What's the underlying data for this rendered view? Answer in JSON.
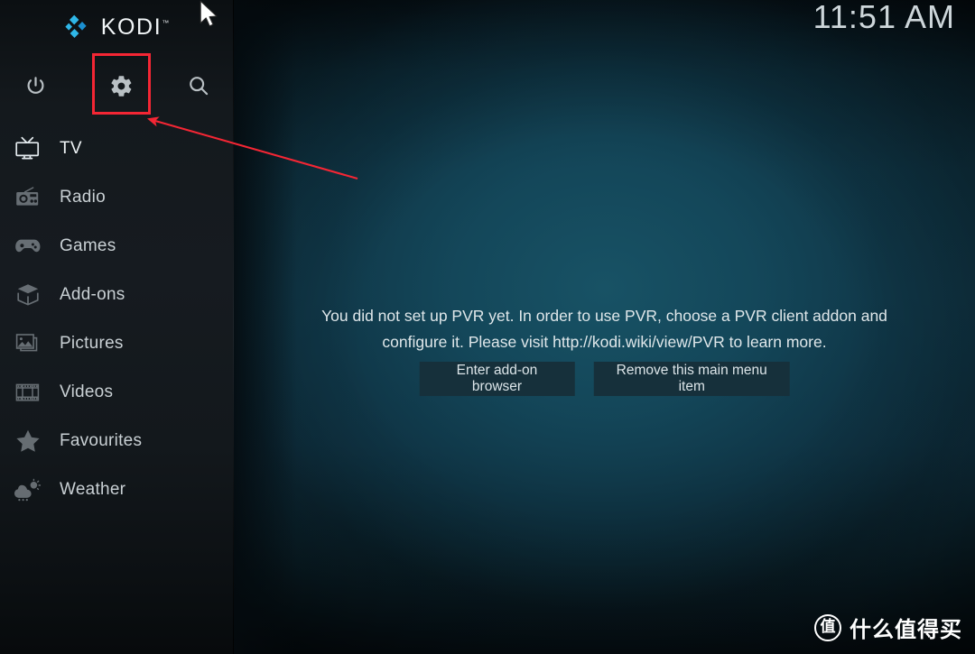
{
  "app": {
    "name": "KODI",
    "trademark": "™"
  },
  "status_bar": {
    "clock": "11:51 AM"
  },
  "sidebar": {
    "top_actions": [
      {
        "name": "power-button",
        "icon": "power-icon",
        "label": "Power"
      },
      {
        "name": "settings-button",
        "icon": "gear-icon",
        "label": "Settings"
      },
      {
        "name": "search-button",
        "icon": "search-icon",
        "label": "Search"
      }
    ],
    "items": [
      {
        "label": "TV",
        "icon": "tv-icon",
        "active": true
      },
      {
        "label": "Radio",
        "icon": "radio-icon",
        "active": false
      },
      {
        "label": "Games",
        "icon": "gamepad-icon",
        "active": false
      },
      {
        "label": "Add-ons",
        "icon": "box-icon",
        "active": false
      },
      {
        "label": "Pictures",
        "icon": "picture-icon",
        "active": false
      },
      {
        "label": "Videos",
        "icon": "filmstrip-icon",
        "active": false
      },
      {
        "label": "Favourites",
        "icon": "star-icon",
        "active": false
      },
      {
        "label": "Weather",
        "icon": "weather-icon",
        "active": false
      }
    ]
  },
  "main": {
    "message": "You did not set up PVR yet. In order to use PVR, choose a PVR client addon and configure it. Please visit http://kodi.wiki/view/PVR to learn more.",
    "buttons": [
      {
        "label": "Enter add-on browser"
      },
      {
        "label": "Remove this main menu item"
      }
    ]
  },
  "annotation": {
    "highlight_target": "settings-button",
    "color": "#f42634"
  },
  "watermark": {
    "logo_char": "值",
    "text": "什么值得买"
  },
  "colors": {
    "accent_blue": "#31b5e8",
    "sidebar_bg": "#14191d",
    "main_bg": "#123c4e",
    "button_bg": "#16303b",
    "annotation_red": "#f42634",
    "text_primary": "#dfe7ea"
  }
}
